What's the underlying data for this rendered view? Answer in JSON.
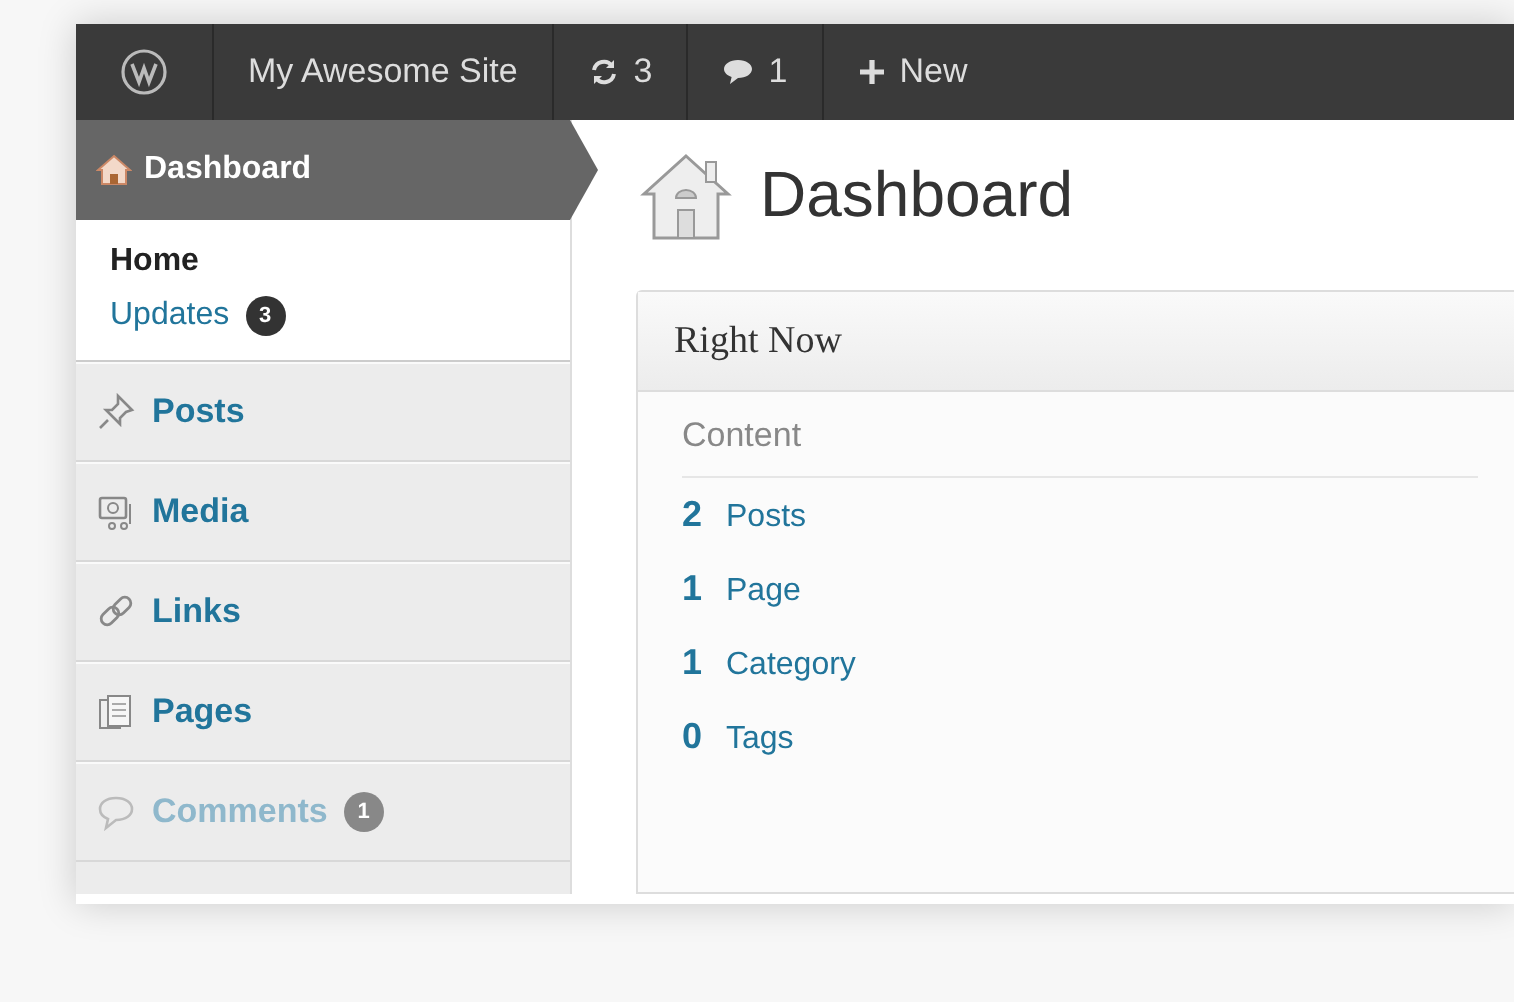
{
  "admin_bar": {
    "site_name": "My Awesome Site",
    "updates_count": "3",
    "comments_count": "1",
    "new_label": "New"
  },
  "sidebar": {
    "current": {
      "label": "Dashboard"
    },
    "submenu": [
      {
        "label": "Home",
        "selected": true
      },
      {
        "label": "Updates",
        "selected": false,
        "badge": "3"
      }
    ],
    "items": [
      {
        "label": "Posts"
      },
      {
        "label": "Media"
      },
      {
        "label": "Links"
      },
      {
        "label": "Pages"
      },
      {
        "label": "Comments",
        "badge": "1"
      }
    ]
  },
  "page_title": "Dashboard",
  "right_now": {
    "title": "Right Now",
    "section": "Content",
    "rows": [
      {
        "count": "2",
        "label": "Posts"
      },
      {
        "count": "1",
        "label": "Page"
      },
      {
        "count": "1",
        "label": "Category"
      },
      {
        "count": "0",
        "label": "Tags"
      }
    ]
  }
}
